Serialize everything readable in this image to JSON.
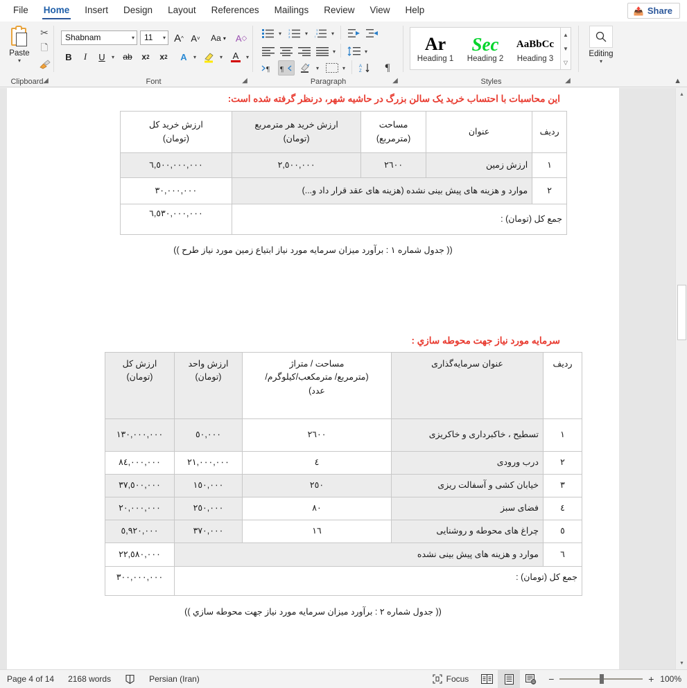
{
  "app": {
    "share_label": "Share"
  },
  "tabs": [
    {
      "label": "File"
    },
    {
      "label": "Home"
    },
    {
      "label": "Insert"
    },
    {
      "label": "Design"
    },
    {
      "label": "Layout"
    },
    {
      "label": "References"
    },
    {
      "label": "Mailings"
    },
    {
      "label": "Review"
    },
    {
      "label": "View"
    },
    {
      "label": "Help"
    }
  ],
  "ribbon": {
    "clipboard": {
      "label": "Clipboard",
      "paste_label": "Paste",
      "cut_icon": "scissors-icon",
      "copy_icon": "copy-icon",
      "format_painter_icon": "format-painter-icon",
      "dialog_icon": "dialog-launcher-icon"
    },
    "font": {
      "label": "Font",
      "font_name": "Shabnam",
      "font_size": "11",
      "grow_font": "A",
      "shrink_font": "A",
      "change_case": "Aa",
      "clear_formatting": "A",
      "bold": "B",
      "italic": "I",
      "underline": "U",
      "strikethrough": "ab",
      "subscript": "x",
      "subscript_sup": "2",
      "superscript": "x",
      "superscript_sup": "2",
      "text_effects": "A",
      "highlight": "A",
      "font_color": "A",
      "dialog_icon": "dialog-launcher-icon"
    },
    "paragraph": {
      "label": "Paragraph",
      "dialog_icon": "dialog-launcher-icon"
    },
    "styles": {
      "label": "Styles",
      "items": [
        {
          "preview": "Ar",
          "name": "Heading 1",
          "color": "#000000"
        },
        {
          "preview": "Sec",
          "name": "Heading 2",
          "color": "#00d42a"
        },
        {
          "preview": "AaBbCc",
          "name": "Heading 3",
          "color": "#000000"
        }
      ],
      "dialog_icon": "dialog-launcher-icon"
    },
    "editing": {
      "label": "Editing",
      "icon": "search-icon"
    }
  },
  "document": {
    "intro_note": "این محاسبات با احتساب خرید یک سالن بزرگ در حاشیه شهر، درنظر گرفته شده است:",
    "table1": {
      "headers": [
        "ردیف",
        "عنوان",
        "مساحت\n(مترمربع)",
        "ارزش خرید هر مترمربع\n(تومان)",
        "ارزش خرید کل\n(تومان)"
      ],
      "header_cells": [
        {
          "line1": "ردیف",
          "line2": ""
        },
        {
          "line1": "عنوان",
          "line2": ""
        },
        {
          "line1": "مساحت",
          "line2": "(مترمربع)"
        },
        {
          "line1": "ارزش خرید هر مترمربع",
          "line2": "(تومان)"
        },
        {
          "line1": "ارزش خرید کل",
          "line2": "(تومان)"
        }
      ],
      "rows": [
        {
          "num": "١",
          "title": "ارزش زمین",
          "area": "٢٦٠٠",
          "unit_value": "٢,٥٠٠,٠٠٠",
          "total": "٦,٥٠٠,٠٠٠,٠٠٠"
        },
        {
          "num": "٢",
          "title": "موارد و هزینه های پیش بینی نشده (هزینه های عقد قرار داد و...)",
          "area": "",
          "unit_value": "",
          "total": "٣٠,٠٠٠,٠٠٠"
        }
      ],
      "total_label": "جمع کل (تومان) :",
      "total_value": "٦,٥٣٠,٠٠٠,٠٠٠"
    },
    "caption1": "(( جدول شماره ١ : برآورد میزان سرمایه مورد نیاز ابتیاع زمین مورد نیاز طرح ))",
    "section2_heading": "سرمایه مورد نیاز جهت محوطه سازي :",
    "table2": {
      "header_cells": [
        {
          "line1": "ردیف",
          "line2": "",
          "line3": ""
        },
        {
          "line1": "عنوان سرمایه‌گذاری",
          "line2": "",
          "line3": ""
        },
        {
          "line1": "مساحت / متراژ",
          "line2": "(مترمربع/ مترمکعب/کیلوگرم/",
          "line3": "عدد)"
        },
        {
          "line1": "ارزش واحد",
          "line2": "(تومان)",
          "line3": ""
        },
        {
          "line1": "ارزش کل",
          "line2": "(تومان)",
          "line3": ""
        }
      ],
      "rows": [
        {
          "num": "١",
          "title": "تسطیح ، خاکبرداری و خاکریزی",
          "qty": "٢٦٠٠",
          "unit_value": "٥٠,٠٠٠",
          "total": "١٣٠,٠٠٠,٠٠٠"
        },
        {
          "num": "٢",
          "title": "درب ورودی",
          "qty": "٤",
          "unit_value": "٢١,٠٠٠,٠٠٠",
          "total": "٨٤,٠٠٠,٠٠٠"
        },
        {
          "num": "٣",
          "title": "خیابان کشی و آسفالت ریزی",
          "qty": "٢٥٠",
          "unit_value": "١٥٠,٠٠٠",
          "total": "٣٧,٥٠٠,٠٠٠"
        },
        {
          "num": "٤",
          "title": "فضای سبز",
          "qty": "٨٠",
          "unit_value": "٢٥٠,٠٠٠",
          "total": "٢٠,٠٠٠,٠٠٠"
        },
        {
          "num": "٥",
          "title": "چراغ های محوطه و روشنایی",
          "qty": "١٦",
          "unit_value": "٣٧٠,٠٠٠",
          "total": "٥,٩٢٠,٠٠٠"
        },
        {
          "num": "٦",
          "title": "موارد و هزینه های پیش بینی نشده",
          "qty": "",
          "unit_value": "",
          "total": "٢٢,٥٨٠,٠٠٠"
        }
      ],
      "total_label": "جمع کل (تومان) :",
      "total_value": "٣٠٠,٠٠٠,٠٠٠"
    },
    "caption2": "(( جدول شماره ٢ : برآورد میزان سرمایه مورد نیاز جهت محوطه سازي ))"
  },
  "status": {
    "page": "Page 4 of 14",
    "words": "2168 words",
    "proofing_icon": "proofing-errors-icon",
    "language": "Persian (Iran)",
    "focus": "Focus",
    "read_mode_icon": "read-mode-icon",
    "print_layout_icon": "print-layout-icon",
    "web_layout_icon": "web-layout-icon",
    "zoom_out": "−",
    "zoom_in": "+",
    "zoom": "100%"
  }
}
